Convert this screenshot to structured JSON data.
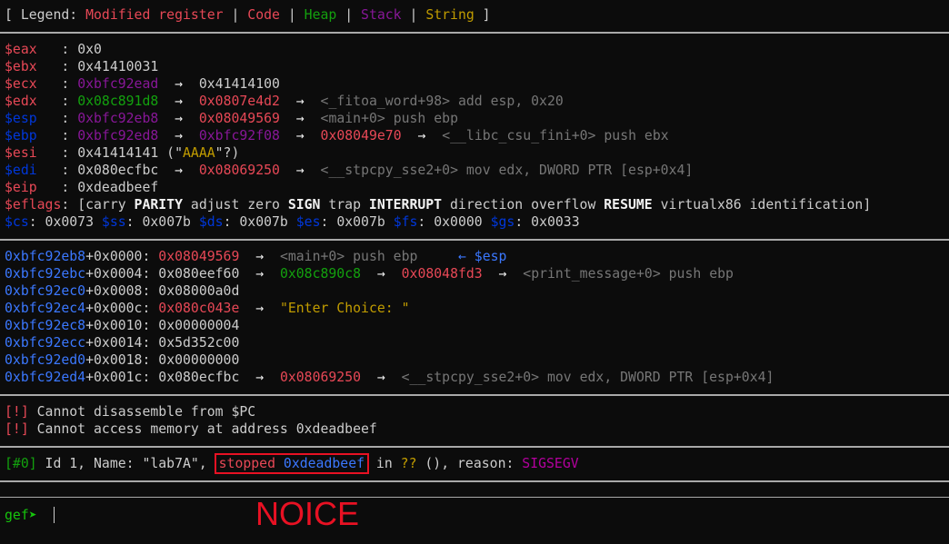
{
  "legend": {
    "open": "[ Legend: ",
    "sep": " | ",
    "close": " ]",
    "modified": "Modified register",
    "code": "Code",
    "heap": "Heap",
    "stack": "Stack",
    "string": "String"
  },
  "arrow": "→",
  "registers": {
    "eax": {
      "name": "$eax",
      "colon": "   : ",
      "v1": "0x0"
    },
    "ebx": {
      "name": "$ebx",
      "colon": "   : ",
      "v1": "0x41410031"
    },
    "ecx": {
      "name": "$ecx",
      "colon": "   : ",
      "v1": "0xbfc92ead",
      "v2": "0x41414100"
    },
    "edx": {
      "name": "$edx",
      "colon": "   : ",
      "v1": "0x08c891d8",
      "v2": "0x0807e4d2",
      "sym": "<_fitoa_word+98> add esp, 0x20"
    },
    "esp": {
      "name": "$esp",
      "colon": "   : ",
      "v1": "0xbfc92eb8",
      "v2": "0x08049569",
      "sym": "<main+0> push ebp"
    },
    "ebp": {
      "name": "$ebp",
      "colon": "   : ",
      "v1": "0xbfc92ed8",
      "v2": "0xbfc92f08",
      "v3": "0x08049e70",
      "sym": "<__libc_csu_fini+0> push ebx"
    },
    "esi": {
      "name": "$esi",
      "colon": "   : ",
      "v1": "0x41414141 (\"",
      "str": "AAAA",
      "tail": "\"?)"
    },
    "edi": {
      "name": "$edi",
      "colon": "   : ",
      "v1": "0x080ecfbc",
      "v2": "0x08069250",
      "sym": "<__stpcpy_sse2+0> mov edx, DWORD PTR [esp+0x4]"
    },
    "eip": {
      "name": "$eip",
      "colon": "   : ",
      "v1": "0xdeadbeef"
    },
    "eflags": {
      "name": "$eflags",
      "colon": ": ",
      "p1": "[carry ",
      "f1": "PARITY",
      "p2": " adjust zero ",
      "f2": "SIGN",
      "p3": " trap ",
      "f3": "INTERRUPT",
      "p4": " direction overflow ",
      "f4": "RESUME",
      "p5": " virtualx86 identification]"
    },
    "segments": {
      "cs": "$cs",
      "cs_v": ": 0x0073 ",
      "ss": "$ss",
      "ss_v": ": 0x007b ",
      "ds": "$ds",
      "ds_v": ": 0x007b ",
      "es": "$es",
      "es_v": ": 0x007b ",
      "fs": "$fs",
      "fs_v": ": 0x0000 ",
      "gs": "$gs",
      "gs_v": ": 0x0033"
    }
  },
  "stack": {
    "r0": {
      "addr": "0xbfc92eb8",
      "off": "+0x0000: ",
      "v1": "0x08049569",
      "sym": "<main+0> push ebp",
      "tag_arrow": "←",
      "tag": "$esp"
    },
    "r1": {
      "addr": "0xbfc92ebc",
      "off": "+0x0004: ",
      "v1": "0x080eef60",
      "v2": "0x08c890c8",
      "v3": "0x08048fd3",
      "sym": "<print_message+0> push ebp"
    },
    "r2": {
      "addr": "0xbfc92ec0",
      "off": "+0x0008: ",
      "v1": "0x08000a0d"
    },
    "r3": {
      "addr": "0xbfc92ec4",
      "off": "+0x000c: ",
      "v1": "0x080c043e",
      "str": "\"Enter Choice: \""
    },
    "r4": {
      "addr": "0xbfc92ec8",
      "off": "+0x0010: ",
      "v1": "0x00000004"
    },
    "r5": {
      "addr": "0xbfc92ecc",
      "off": "+0x0014: ",
      "v1": "0x5d352c00"
    },
    "r6": {
      "addr": "0xbfc92ed0",
      "off": "+0x0018: ",
      "v1": "0x00000000"
    },
    "r7": {
      "addr": "0xbfc92ed4",
      "off": "+0x001c: ",
      "v1": "0x080ecfbc",
      "v2": "0x08069250",
      "sym": "<__stpcpy_sse2+0> mov edx, DWORD PTR [esp+0x4]"
    }
  },
  "errors": {
    "tag": "[!]",
    "msg1": " Cannot disassemble from $PC",
    "msg2": " Cannot access memory at address 0xdeadbeef"
  },
  "thread": {
    "tag": "[#0]",
    "p1": " Id 1, Name: \"lab7A\", ",
    "stopped": "stopped",
    "addr": "0xdeadbeef",
    "p2": " in ",
    "fn": "??",
    "p3": " (), reason: ",
    "reason": "SIGSEGV"
  },
  "prompt": "gef➤ ",
  "annotation": "NOICE"
}
